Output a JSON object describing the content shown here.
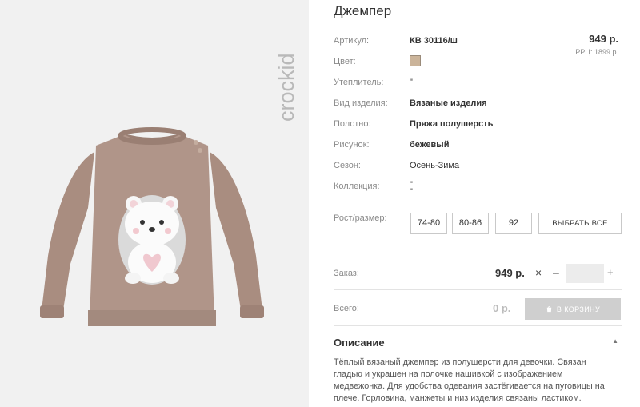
{
  "brand": {
    "logo_text": "crockid"
  },
  "product": {
    "title": "Джемпер",
    "price": "949 р.",
    "rrc": "РРЦ: 1899 р."
  },
  "attributes": [
    {
      "label": "Артикул:",
      "value": "КВ 30116/ш"
    },
    {
      "label": "Цвет:",
      "value": ""
    },
    {
      "label": "Утеплитель:",
      "value": "\""
    },
    {
      "label": "Вид изделия:",
      "value": "Вязаные изделия"
    },
    {
      "label": "Полотно:",
      "value": "Пряжа полушерсть"
    },
    {
      "label": "Рисунок:",
      "value": "бежевый"
    },
    {
      "label": "Сезон:",
      "value": "Осень-Зима"
    },
    {
      "label": "Коллекция:",
      "value": "\"",
      "value2": "\""
    }
  ],
  "color_swatch": "#cbb49a",
  "sizes": {
    "label": "Рост/размер:",
    "options": [
      "74-80",
      "80-86",
      "92"
    ],
    "select_all": "ВЫБРАТЬ ВСЕ"
  },
  "order": {
    "label": "Заказ:",
    "price": "949 р.",
    "times": "×",
    "minus": "–",
    "plus": "+",
    "quantity": ""
  },
  "total": {
    "label": "Всего:",
    "value": "0 р.",
    "cart_button": "В КОРЗИНУ"
  },
  "description": {
    "title": "Описание",
    "text": "Тёплый вязаный джемпер из полушерсти для девочки. Связан гладью и украшен на полочке нашивкой с изображением медвежонка. Для удобства одевания застёгивается на пуговицы на плече. Горловина, манжеты и низ изделия связаны ластиком."
  }
}
